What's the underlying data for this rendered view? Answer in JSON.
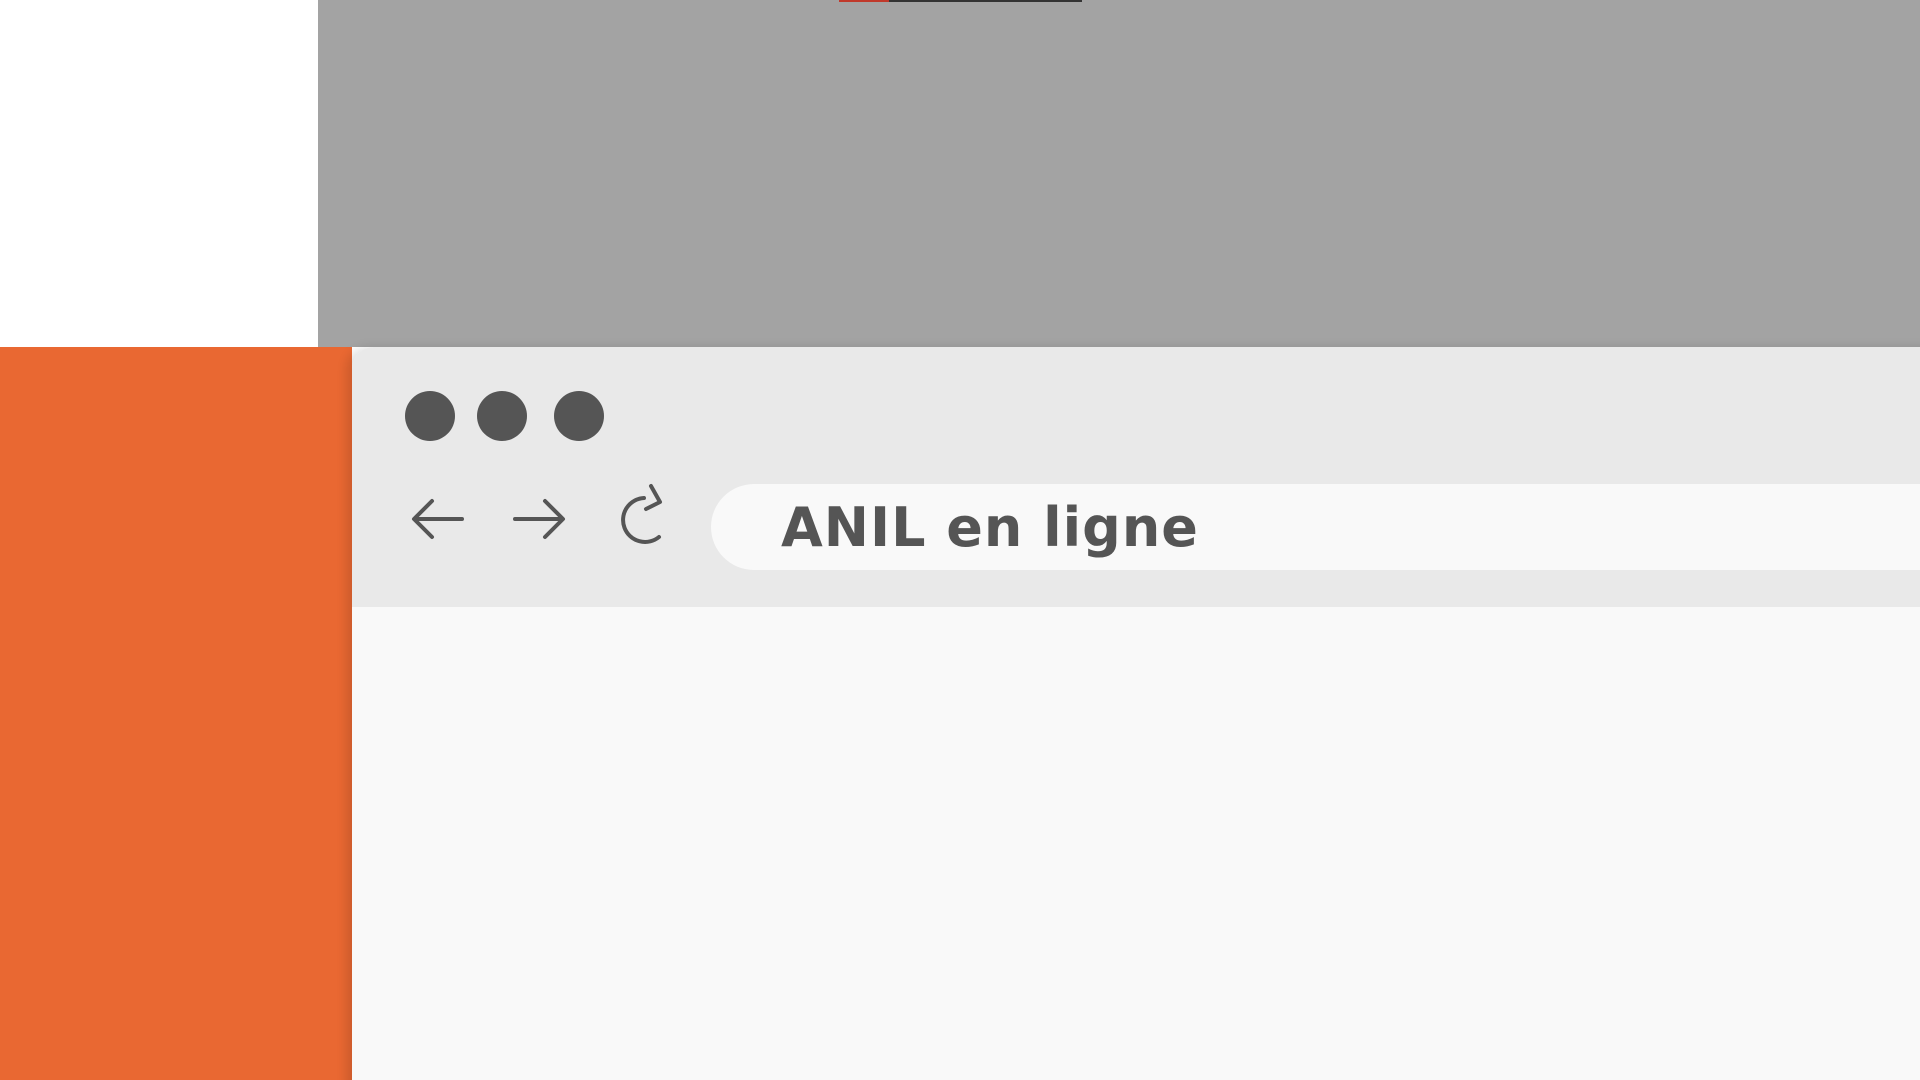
{
  "browser": {
    "address_bar": {
      "text": "ANIL en ligne"
    },
    "window_controls": [
      "close-dot",
      "minimize-dot",
      "maximize-dot"
    ],
    "toolbar": {
      "icons": [
        "arrow-left-icon",
        "arrow-right-icon",
        "reload-icon"
      ]
    }
  },
  "colors": {
    "orange_panel": "#e96832",
    "gray_panel": "#a3a3a3",
    "chrome_bg": "#e9e9e9",
    "icon_color": "#555555",
    "content_bg": "#f9f9f9"
  }
}
